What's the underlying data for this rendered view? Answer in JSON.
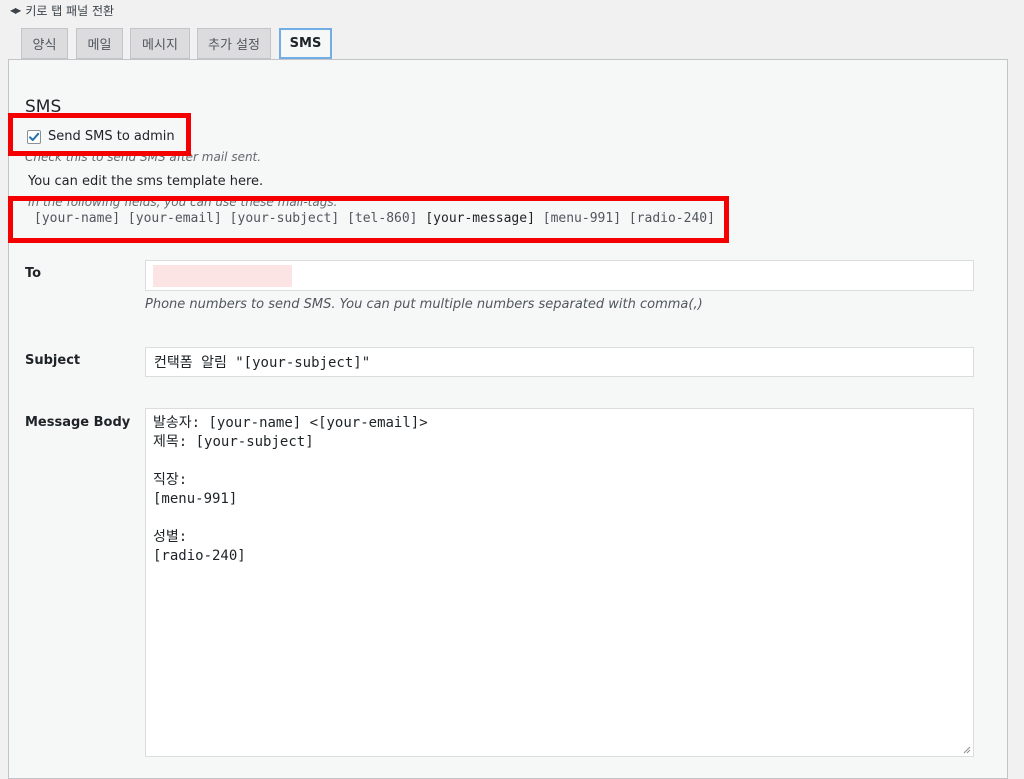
{
  "keyboard_toggle": {
    "arrows": "◀▶",
    "label": "키로 탭 패널 전환"
  },
  "tabs": [
    {
      "label": "양식"
    },
    {
      "label": "메일"
    },
    {
      "label": "메시지"
    },
    {
      "label": "추가 설정"
    },
    {
      "label": "SMS",
      "active": true
    }
  ],
  "sms": {
    "title": "SMS",
    "checkbox_label": "Send SMS to admin",
    "checkbox_checked": true,
    "checkbox_desc": "Check this to send SMS after mail sent.",
    "edit_note": "You can edit the sms template here.",
    "fields_note": "In the following fields, you can use these mail-tags:",
    "tags_before": "[your-name] [your-email] [your-subject] [tel-860] ",
    "tag_strong": "[your-message]",
    "tags_after": " [menu-991] [radio-240]"
  },
  "form": {
    "to_label": "To",
    "to_value": "",
    "to_hint": "Phone numbers to send SMS. You can put multiple numbers separated with comma(,)",
    "subject_label": "Subject",
    "subject_value": "컨택폼 알림 \"[your-subject]\"",
    "body_label": "Message Body",
    "body_value": "발송자: [your-name] <[your-email]>\n제목: [your-subject]\n\n직장:\n[menu-991]\n\n성별:\n[radio-240]"
  },
  "colors": {
    "highlight_red": "#f50000",
    "active_tab_border": "#72aee6",
    "check_blue": "#2271b1"
  }
}
